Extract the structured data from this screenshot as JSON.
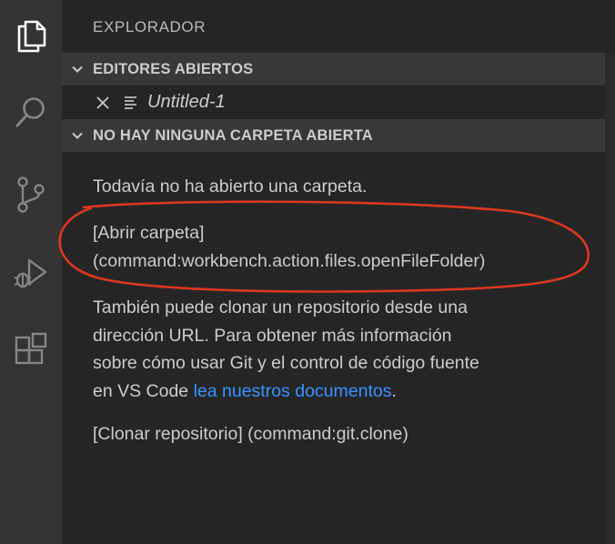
{
  "activity_bar": {
    "items": [
      {
        "icon": "files-icon",
        "active": true
      },
      {
        "icon": "search-icon",
        "active": false
      },
      {
        "icon": "source-control-icon",
        "active": false
      },
      {
        "icon": "run-debug-icon",
        "active": false
      },
      {
        "icon": "extensions-icon",
        "active": false
      }
    ]
  },
  "sidebar": {
    "title": "EXPLORADOR",
    "open_editors": {
      "header": "EDITORES ABIERTOS",
      "items": [
        {
          "name": "Untitled-1"
        }
      ]
    },
    "no_folder": {
      "header": "NO HAY NINGUNA CARPETA ABIERTA",
      "message": "Todavía no ha abierto una carpeta.",
      "open_folder_line1": "[Abrir carpeta]",
      "open_folder_line2": "(command:workbench.action.files.openFileFolder)",
      "clone_text_line1": "También puede clonar un repositorio desde una",
      "clone_text_line2": "dirección URL. Para obtener más información",
      "clone_text_line3": "sobre cómo usar Git y el control de código fuente",
      "clone_text_line4_prefix": "en VS Code ",
      "docs_link": "lea nuestros documentos",
      "clone_text_line4_suffix": ".",
      "clone_command": "[Clonar repositorio] (command:git.clone)"
    }
  },
  "colors": {
    "activity_bar_bg": "#333333",
    "sidebar_bg": "#252526",
    "section_header_bg": "#383838",
    "text": "#cccccc",
    "link": "#3794ff",
    "annotation": "#d9381e"
  }
}
